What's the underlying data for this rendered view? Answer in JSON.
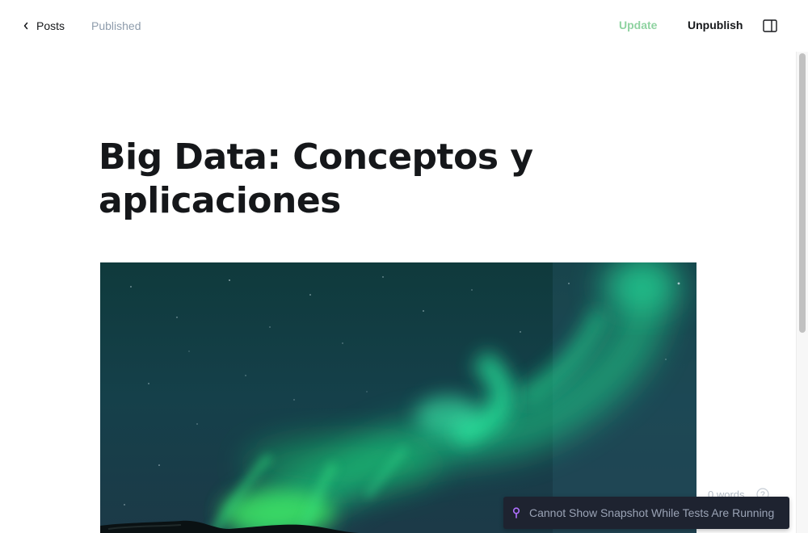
{
  "header": {
    "back_label": "Posts",
    "status": "Published",
    "update_label": "Update",
    "unpublish_label": "Unpublish"
  },
  "post": {
    "title": "Big Data: Conceptos y aplicaciones"
  },
  "editor": {
    "word_count": "0 words"
  },
  "toast": {
    "message": "Cannot Show Snapshot While Tests Are Running"
  },
  "colors": {
    "accent_green": "#8fd3a1",
    "toast_bg": "#1e2330",
    "toast_icon": "#b070ff"
  },
  "icons": [
    "chevron-left-icon",
    "sidebar-toggle-icon",
    "help-icon",
    "pin-icon"
  ]
}
